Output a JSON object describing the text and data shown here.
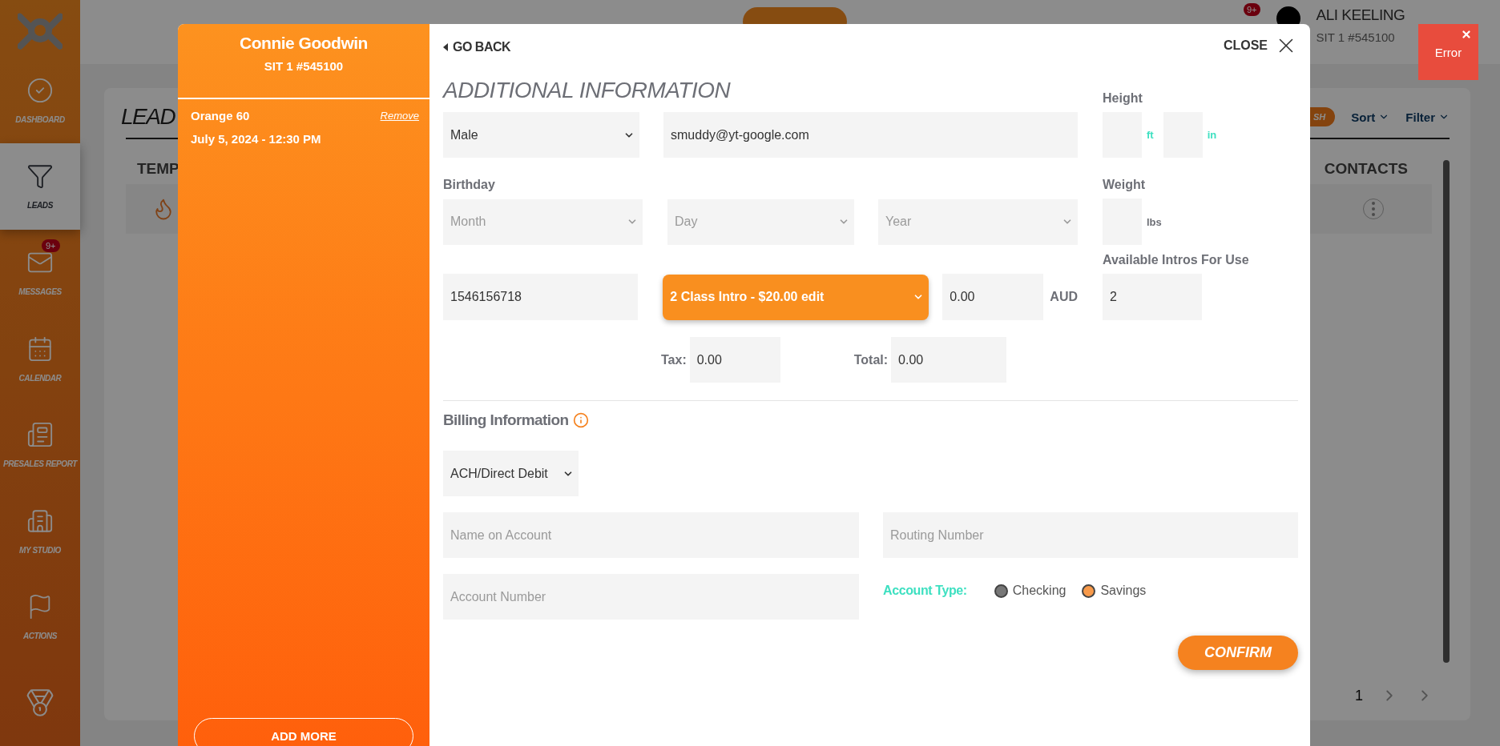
{
  "sidebar": {
    "items": [
      {
        "label": "DASHBOARD",
        "selected": false
      },
      {
        "label": "LEADS",
        "selected": true
      },
      {
        "label": "MESSAGES",
        "selected": false,
        "badge": "9+"
      },
      {
        "label": "CALENDAR",
        "selected": false
      },
      {
        "label": "PRESALES REPORT",
        "selected": false
      },
      {
        "label": "MY STUDIO",
        "selected": false
      },
      {
        "label": "ACTIONS",
        "selected": false
      }
    ]
  },
  "header": {
    "notification_badge": "9+",
    "user": {
      "name": "ALI KEELING",
      "studio": "SIT 1 #545100"
    }
  },
  "error_toast": {
    "label": "Error"
  },
  "leads": {
    "title": "LEAD",
    "action_button": "SH",
    "sort": "Sort",
    "filter": "Filter",
    "columns": [
      "TEMP",
      "CONTACTS"
    ],
    "page": "1"
  },
  "modal": {
    "lead": {
      "name": "Connie Goodwin",
      "studio": "SIT 1 #545100"
    },
    "cart": [
      {
        "title": "Orange 60",
        "date": "July 5, 2024 - 12:30 PM",
        "remove": "Remove"
      }
    ],
    "add_more": "ADD MORE",
    "go_back": "GO BACK",
    "close": "CLOSE",
    "title": "ADDITIONAL INFORMATION",
    "form": {
      "gender": "Male",
      "email": "smuddy@yt-google.com",
      "height_label": "Height",
      "feet_unit": "ft",
      "inches_unit": "in",
      "birthday_label": "Birthday",
      "month": {
        "placeholder": "Month"
      },
      "day": {
        "placeholder": "Day"
      },
      "year": {
        "placeholder": "Year"
      },
      "weight_label": "Weight",
      "weight_unit": "lbs",
      "intros_label": "Available Intros For Use",
      "phone": "1546156718",
      "package": "2 Class Intro - $20.00 edit",
      "amount": "0.00",
      "currency": "AUD",
      "intros": "2",
      "tax_label": "Tax:",
      "tax": "0.00",
      "total_label": "Total:",
      "total": "0.00"
    },
    "billing": {
      "title": "Billing Information",
      "method": "ACH/Direct Debit",
      "name_on_account": {
        "placeholder": "Name on Account"
      },
      "routing_number": {
        "placeholder": "Routing Number"
      },
      "account_number": {
        "placeholder": "Account Number"
      },
      "account_type_label": "Account Type:",
      "account_types": [
        {
          "label": "Checking",
          "selected": false
        },
        {
          "label": "Savings",
          "selected": true
        }
      ]
    },
    "confirm": "CONFIRM"
  }
}
